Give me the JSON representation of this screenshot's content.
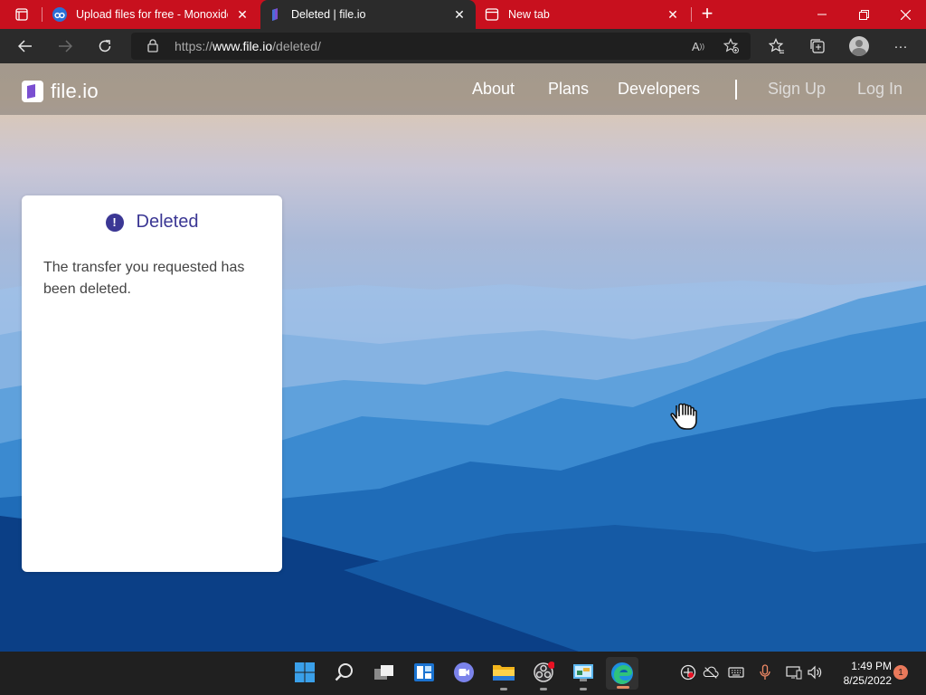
{
  "browser": {
    "tabs": [
      {
        "title": "Upload files for free - Monoxide",
        "favicon": "monoxide-icon",
        "active": false
      },
      {
        "title": "Deleted | file.io",
        "favicon": "fileio-icon",
        "active": true
      },
      {
        "title": "New tab",
        "favicon": "newtab-icon",
        "active": false
      }
    ],
    "url_prefix": "https://",
    "url_domain": "www.file.io",
    "url_path": "/deleted/"
  },
  "site": {
    "logo_text": "file.io",
    "nav": {
      "about": "About",
      "plans": "Plans",
      "developers": "Developers",
      "signup": "Sign Up",
      "login": "Log In"
    }
  },
  "card": {
    "title": "Deleted",
    "icon": "!",
    "message": "The transfer you requested has been deleted."
  },
  "taskbar": {
    "time": "1:49 PM",
    "date": "8/25/2022",
    "notification_count": "1"
  },
  "colors": {
    "tab_strip": "#c8101e",
    "accent": "#3b3794",
    "fileio_purple": "#7a4fd1"
  }
}
